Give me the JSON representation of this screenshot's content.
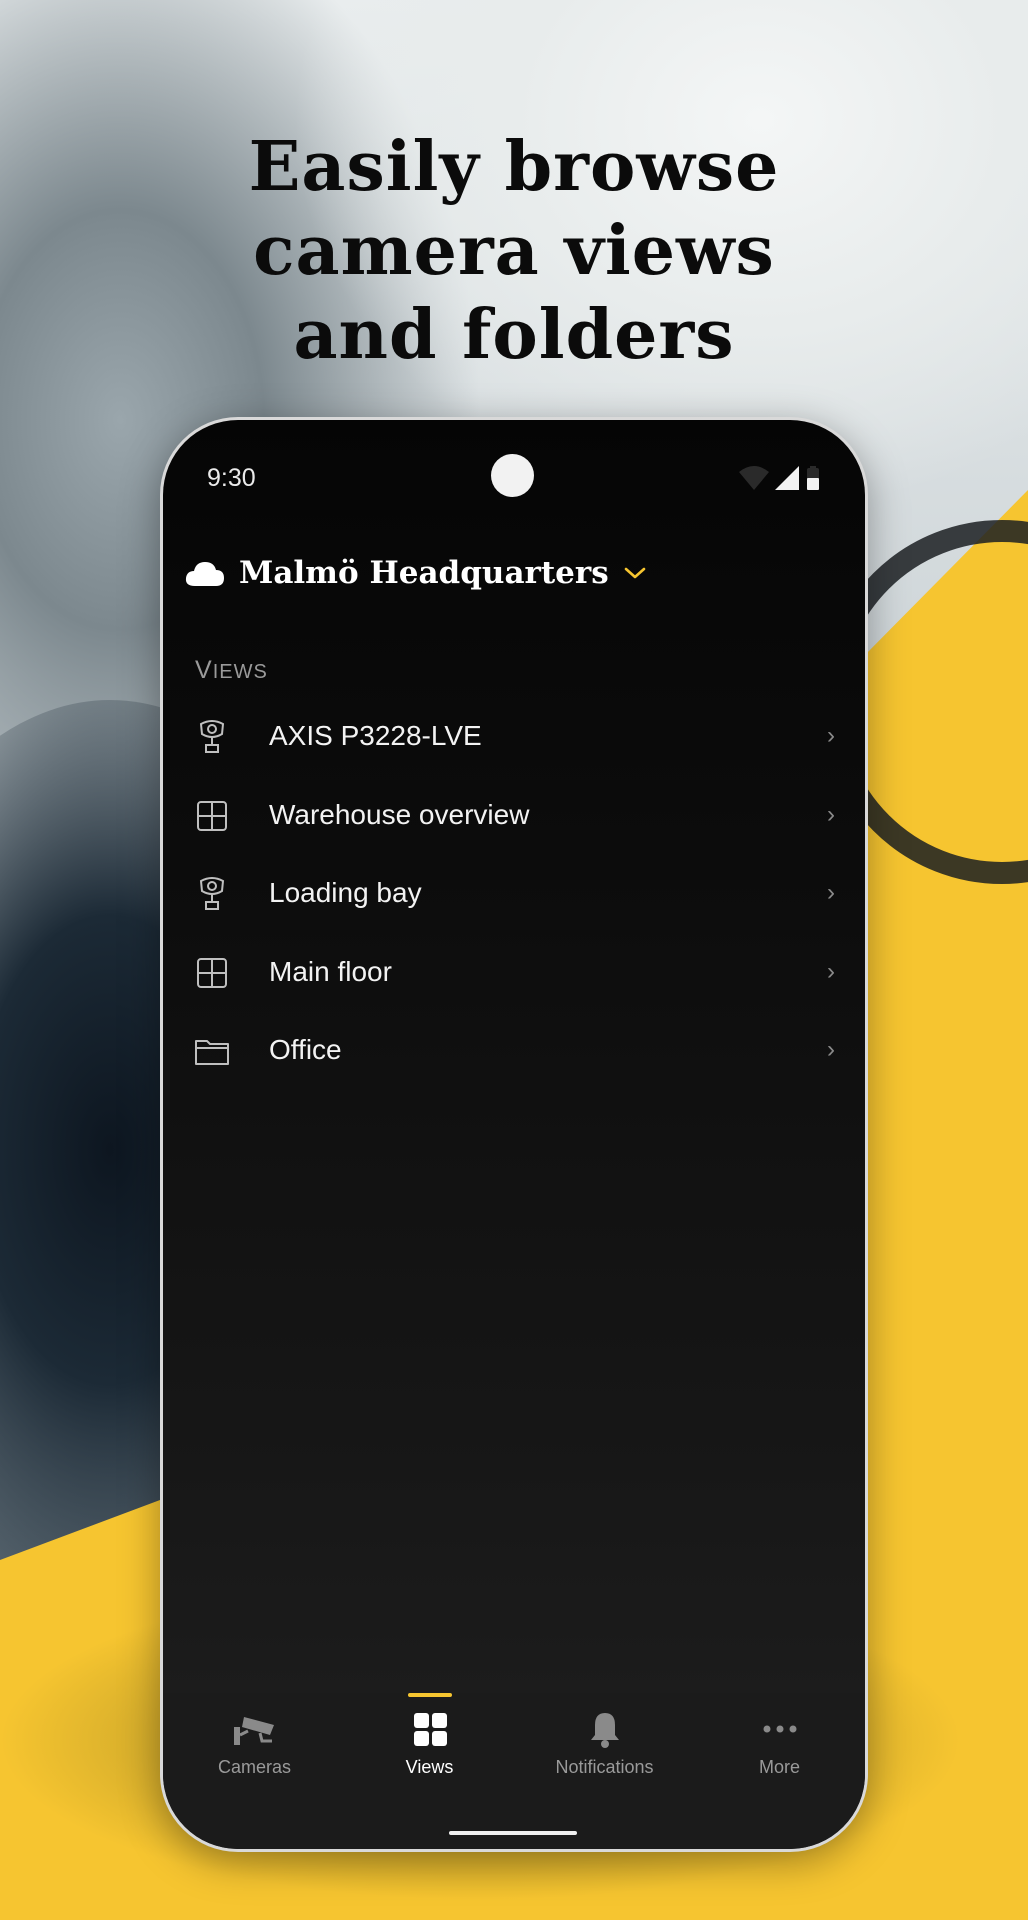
{
  "headline": {
    "line1": "Easily browse",
    "line2": "camera views",
    "line3": "and folders"
  },
  "status_bar": {
    "time": "9:30"
  },
  "site_selector": {
    "name": "Malmö Headquarters",
    "cloud_icon": "cloud-icon",
    "chevron_icon": "chevron-down-icon"
  },
  "views_section": {
    "label_first": "V",
    "label_rest": "IEWS",
    "items": [
      {
        "label": "AXIS P3228-LVE",
        "icon": "camera-icon"
      },
      {
        "label": "Warehouse overview",
        "icon": "grid-view-icon"
      },
      {
        "label": "Loading bay",
        "icon": "camera-icon"
      },
      {
        "label": "Main floor",
        "icon": "grid-view-icon"
      },
      {
        "label": "Office",
        "icon": "folder-icon"
      }
    ],
    "chevron": "›"
  },
  "tabbar": {
    "tabs": [
      {
        "label": "Cameras",
        "icon": "security-camera-icon",
        "active": false
      },
      {
        "label": "Views",
        "icon": "views-grid-icon",
        "active": true
      },
      {
        "label": "Notifications",
        "icon": "bell-icon",
        "active": false
      },
      {
        "label": "More",
        "icon": "more-dots-icon",
        "active": false
      }
    ]
  },
  "colors": {
    "accent": "#f6c530",
    "screen_bg": "#0d0d0d",
    "tabbar_bg": "#1b1b1b",
    "muted_text": "#9a9a9a"
  }
}
